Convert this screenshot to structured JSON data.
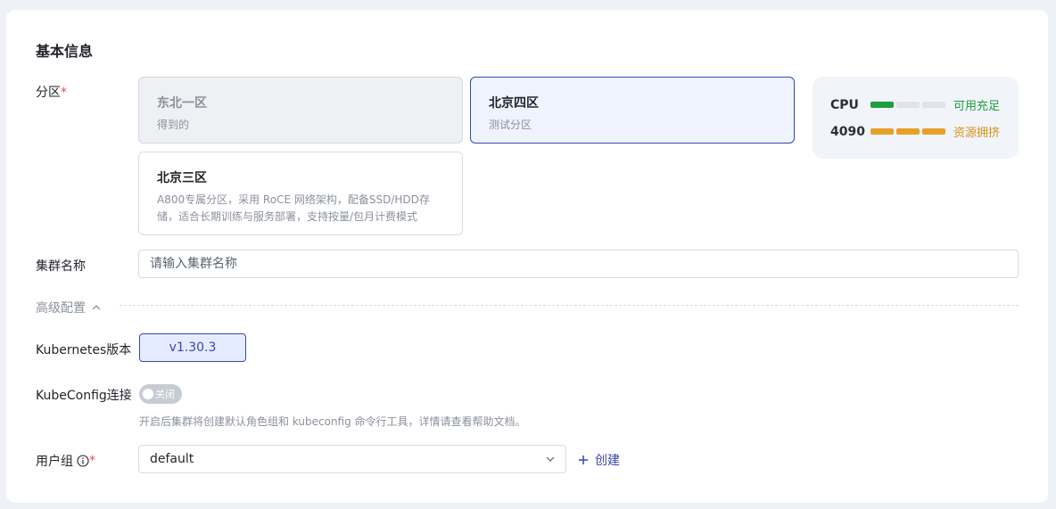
{
  "section_title": "基本信息",
  "zone": {
    "label": "分区",
    "required_mark": "*",
    "options": [
      {
        "name": "东北一区",
        "desc": "得到的",
        "state": "disabled"
      },
      {
        "name": "北京四区",
        "desc": "测试分区",
        "state": "selected"
      },
      {
        "name": "北京三区",
        "desc": "A800专属分区，采用 RoCE 网络架构，配备SSD/HDD存储，适合长期训练与服务部署，支持按量/包月计费模式",
        "state": "normal"
      }
    ]
  },
  "resources": [
    {
      "name": "CPU",
      "status": "可用充足",
      "filled": 1,
      "total": 3,
      "color": "#1e9e3e"
    },
    {
      "name": "4090",
      "status": "资源拥挤",
      "filled": 3,
      "total": 3,
      "color": "#e6a02a"
    }
  ],
  "cluster_name": {
    "label": "集群名称",
    "placeholder": "请输入集群名称"
  },
  "advanced": {
    "label": "高级配置",
    "icon": "chevron-up-icon"
  },
  "kubernetes": {
    "label": "Kubernetes版本",
    "version": "v1.30.3"
  },
  "kubeconfig": {
    "label": "KubeConfig连接",
    "toggle_label": "关闭",
    "enabled": false,
    "hint": "开启后集群将创建默认角色组和 kubeconfig 命令行工具，详情请查看帮助文档。"
  },
  "user_group": {
    "label": "用户组",
    "required_mark": "*",
    "value": "default",
    "create_label": "创建"
  },
  "colors": {
    "accent": "#3846b3",
    "required": "#e34d59",
    "ok": "#1e9e3e",
    "warn": "#e6a02a"
  }
}
